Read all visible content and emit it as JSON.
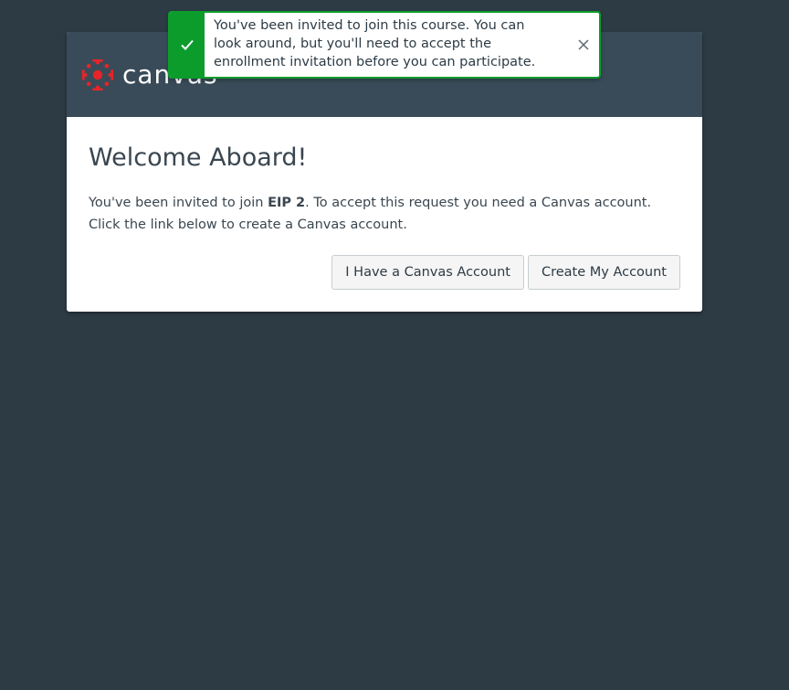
{
  "colors": {
    "page_background": "#2d3b45",
    "header_background": "#394b58",
    "brand_red": "#e72429",
    "success_green": "#0b9c2c"
  },
  "header": {
    "logo_text": "canvas",
    "logo_icon": "canvas-logo-icon"
  },
  "notification": {
    "icon": "checkmark-icon",
    "text": "You've been invited to join this course. You can look around, but you'll need to accept the enrollment invitation before you can participate.",
    "close_icon": "close-icon"
  },
  "main": {
    "title": "Welcome Aboard!",
    "message_prefix": "You've been invited to join ",
    "course_name": "EIP 2",
    "message_suffix": ". To accept this request you need a Canvas account. Click the link below to create a Canvas account.",
    "buttons": {
      "have_account": "I Have a Canvas Account",
      "create_account": "Create My Account"
    }
  }
}
